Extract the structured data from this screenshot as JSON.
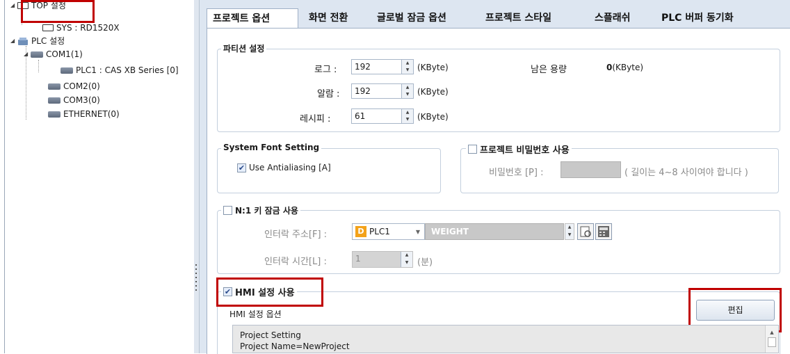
{
  "tree": {
    "items": [
      {
        "label": "TOP 설정",
        "icon": "monitor-icon"
      },
      {
        "label": "SYS : RD1520X",
        "icon": "monitor-icon"
      },
      {
        "label": "PLC 설정",
        "icon": "plc-icon"
      },
      {
        "label": "COM1(1)",
        "icon": "port-icon"
      },
      {
        "label": "PLC1 : CAS XB Series [0]",
        "icon": "port-icon"
      },
      {
        "label": "COM2(0)",
        "icon": "port-icon"
      },
      {
        "label": "COM3(0)",
        "icon": "port-icon"
      },
      {
        "label": "ETHERNET(0)",
        "icon": "port-icon"
      }
    ]
  },
  "tabs": [
    "프로젝트 옵션",
    "화면 전환",
    "글로벌 잠금 옵션",
    "프로젝트 스타일",
    "스플래쉬",
    "PLC 버퍼 동기화"
  ],
  "partition": {
    "title": "파티션 설정",
    "log_label": "로그 :",
    "log_value": "192",
    "alarm_label": "알람 :",
    "alarm_value": "192",
    "recipe_label": "레시피 :",
    "recipe_value": "61",
    "unit": "(KByte)",
    "remaining_label": "남은 용량",
    "remaining_value": "0",
    "remaining_unit": "(KByte)"
  },
  "font": {
    "title": "System Font Setting",
    "antialias_label": "Use Antialiasing [A]",
    "antialias_checked": true
  },
  "password": {
    "title": "프로젝트 비밀번호 사용",
    "label": "비밀번호 [P] :",
    "hint": "( 길이는 4~8 사이여야 합니다 )",
    "checked": false
  },
  "n1": {
    "title": "N:1 키 잠금 사용",
    "addr_label": "인터락 주소[F] :",
    "plc_icon": "D",
    "plc_value": "PLC1",
    "addr_value": "WEIGHT",
    "time_label": "인터락 시간[L] :",
    "time_value": "1",
    "time_unit": "(분)",
    "checked": false
  },
  "hmi": {
    "title": "HMI 설정 사용",
    "checked": true,
    "options_label": "HMI 설정 옵션",
    "edit_button": "편집",
    "text_lines": [
      "Project Setting",
      "Project Name=NewProject"
    ]
  }
}
